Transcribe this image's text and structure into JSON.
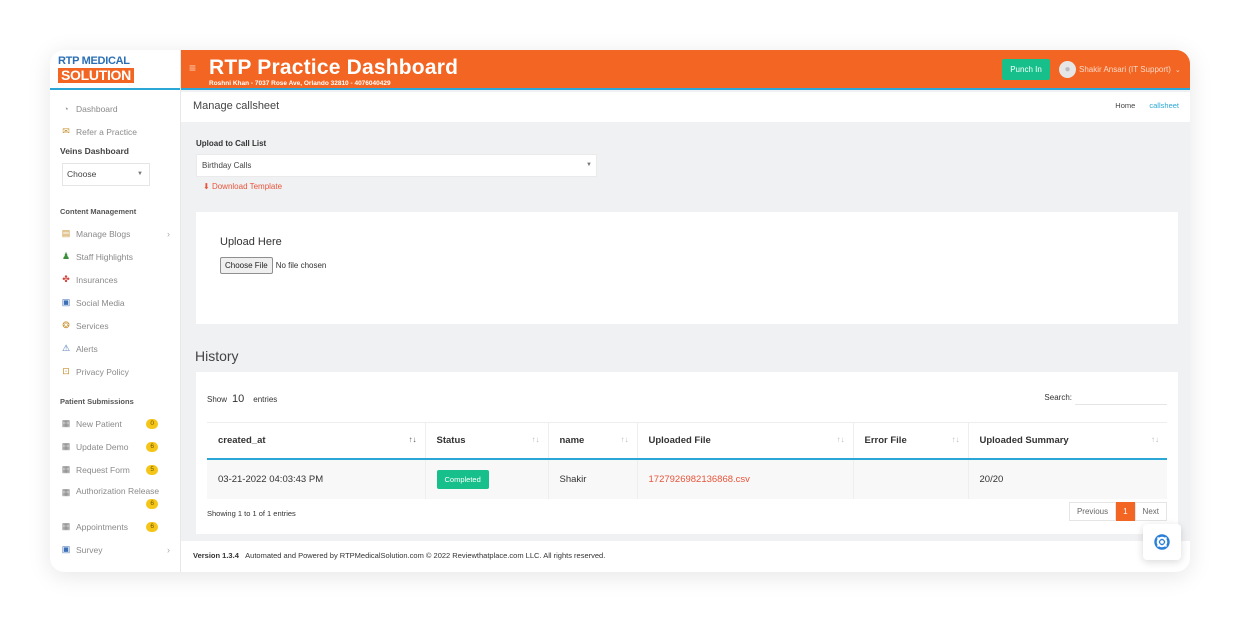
{
  "logo": {
    "line1": "RTP MEDICAL",
    "line2": "SOLUTION"
  },
  "header": {
    "title": "RTP Practice Dashboard",
    "subtitle": "Roshni Khan - 7037 Rose Ave, Orlando 32810 - 4076040429",
    "punch_label": "Punch In",
    "user_name": "Shakir Ansari (IT Support)"
  },
  "sidebar": {
    "dashboard": "Dashboard",
    "refer": "Refer a Practice",
    "veins_title": "Veins Dashboard",
    "veins_select": "Choose",
    "content_title": "Content Management",
    "content_items": [
      {
        "label": "Manage Blogs",
        "icon": "blog-icon"
      },
      {
        "label": "Staff Highlights",
        "icon": "staff-icon"
      },
      {
        "label": "Insurances",
        "icon": "insurance-icon"
      },
      {
        "label": "Social Media",
        "icon": "social-icon"
      },
      {
        "label": "Services",
        "icon": "services-icon"
      },
      {
        "label": "Alerts",
        "icon": "alerts-icon"
      },
      {
        "label": "Privacy Policy",
        "icon": "privacy-icon"
      }
    ],
    "patient_title": "Patient Submissions",
    "patient_items": [
      {
        "label": "New Patient",
        "badge": "0"
      },
      {
        "label": "Update Demo",
        "badge": "6"
      },
      {
        "label": "Request Form",
        "badge": "5"
      },
      {
        "label": "Authorization Release",
        "badge": "6"
      },
      {
        "label": "Appointments",
        "badge": "6"
      },
      {
        "label": "Survey",
        "badge": ""
      }
    ]
  },
  "page": {
    "title": "Manage callsheet",
    "breadcrumb_home": "Home",
    "breadcrumb_current": "callsheet",
    "upload_to_label": "Upload to Call List",
    "call_list_value": "Birthday Calls",
    "download_template": "Download Template",
    "upload_here": "Upload Here",
    "choose_file": "Choose File",
    "no_file": "No file chosen",
    "history_title": "History"
  },
  "table": {
    "show_label": "Show",
    "entries_count": "10",
    "entries_label": "entries",
    "search_label": "Search:",
    "columns": [
      "created_at",
      "Status",
      "name",
      "Uploaded File",
      "Error File",
      "Uploaded Summary"
    ],
    "rows": [
      {
        "created_at": "03-21-2022 04:03:43 PM",
        "status": "Completed",
        "name": "Shakir",
        "uploaded_file": "1727926982136868.csv",
        "error_file": "",
        "summary": "20/20"
      }
    ],
    "showing_text": "Showing 1 to 1 of 1 entries",
    "prev": "Previous",
    "page": "1",
    "next": "Next"
  },
  "footer": {
    "version": "Version 1.3.4",
    "text": "Automated and Powered by RTPMedicalSolution.com © 2022 Reviewthatplace.com LLC. All rights reserved."
  },
  "colors": {
    "brand": "#f26522",
    "accent": "#2aa7d6",
    "success": "#17c08a",
    "badge": "#f5c518"
  }
}
